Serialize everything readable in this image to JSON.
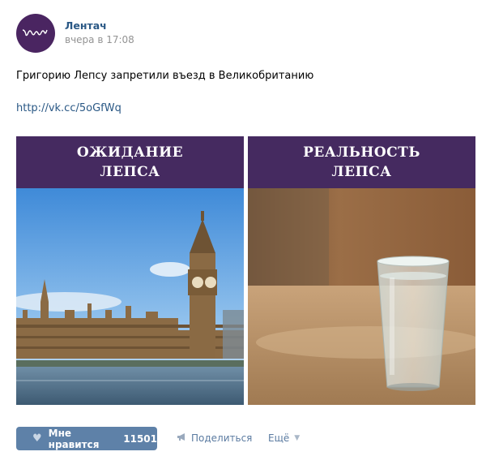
{
  "post": {
    "author": "Лентач",
    "date": "вчера в 17:08",
    "text": "Григорию Лепсу запретили въезд в Великобританию",
    "link": "http://vk.cc/5oGfWq"
  },
  "images": {
    "left": {
      "line1": "ОЖИДАНИЕ",
      "line2": "ЛЕПСА"
    },
    "right": {
      "line1": "РЕАЛЬНОСТЬ",
      "line2": "ЛЕПСА"
    }
  },
  "actions": {
    "like_label": "Мне нравится",
    "like_count": "11501",
    "share_label": "Поделиться",
    "more_label": "Ещё"
  },
  "colors": {
    "brand_purple": "#452a60",
    "link_blue": "#2a5885",
    "like_button": "#5e81a8"
  },
  "icons": [
    "lentach-logo-icon",
    "heart-icon",
    "megaphone-icon",
    "chevron-down-icon"
  ]
}
